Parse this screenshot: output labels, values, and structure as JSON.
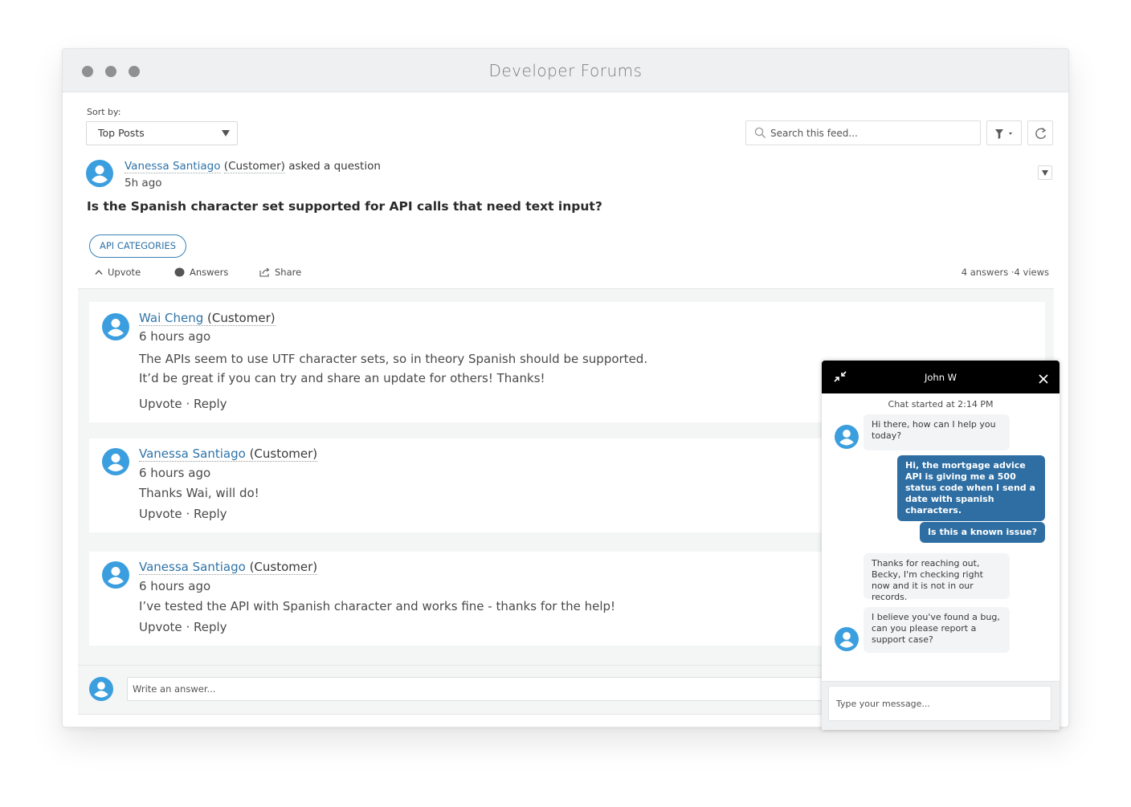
{
  "window": {
    "title": "Developer Forums"
  },
  "toolbar": {
    "sort_label": "Sort by:",
    "sort_value": "Top Posts",
    "search_placeholder": "Search this feed..."
  },
  "post": {
    "author": "Vanessa Santiago",
    "role": "(Customer)",
    "action": "asked a question",
    "time": "5h ago",
    "question": "Is the Spanish character set supported for API calls that need text input?",
    "tag": "API CATEGORIES",
    "actions": {
      "upvote": "Upvote",
      "answers": "Answers",
      "share": "Share"
    },
    "stats": {
      "answers": "4 answers",
      "separator": "·",
      "views": "4 views"
    }
  },
  "answers": [
    {
      "author": "Wai Cheng",
      "role": "(Customer)",
      "time": "6 hours ago",
      "body": [
        "The APIs seem to use UTF character sets, so in theory Spanish should be supported.",
        "It’d be great if you can try and share an update for others! Thanks!"
      ],
      "upvote": "Upvote",
      "reply": "· Reply"
    },
    {
      "author": "Vanessa Santiago",
      "role": "(Customer)",
      "time": "6 hours ago",
      "body": [
        "Thanks Wai, will do!"
      ],
      "upvote": "Upvote",
      "reply": "· Reply"
    },
    {
      "author": "Vanessa Santiago",
      "role": "(Customer)",
      "time": "6 hours ago",
      "body": [
        "I’ve tested the API with Spanish character and works fine - thanks for the help!"
      ],
      "upvote": "Upvote",
      "reply": "· Reply"
    }
  ],
  "composer": {
    "placeholder": "Write an answer..."
  },
  "chat": {
    "agent": "John W",
    "started": "Chat started at 2:14 PM",
    "messages": [
      {
        "from": "agent",
        "text": "Hi there, how can I help you today?"
      },
      {
        "from": "user",
        "text": "Hi, the mortgage advice API is giving me a 500 status code when I send a date with spanish characters."
      },
      {
        "from": "user",
        "text": "Is this a known issue?"
      },
      {
        "from": "agent",
        "text": "Thanks for reaching out, Becky, I'm checking right now and it is not in our records."
      },
      {
        "from": "agent",
        "text": "I believe you've found a bug, can you please report a support case?"
      }
    ],
    "input_placeholder": "Type your message..."
  },
  "colors": {
    "link": "#2f73a8",
    "avatar": "#3b9ede",
    "user_bubble": "#2e6ea3",
    "chat_header": "#000000"
  }
}
